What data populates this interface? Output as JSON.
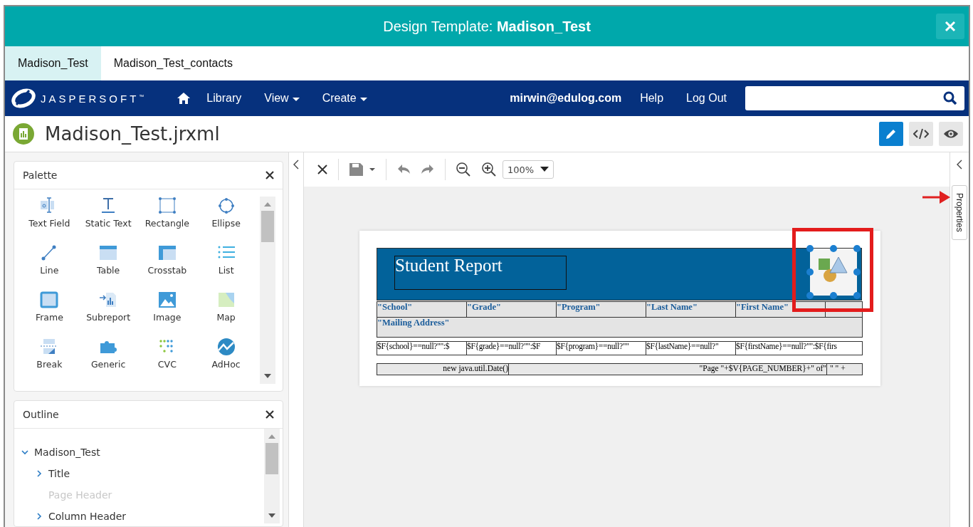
{
  "window": {
    "title_prefix": "Design Template: ",
    "title_name": "Madison_Test"
  },
  "tabs": [
    {
      "label": "Madison_Test",
      "selected": true
    },
    {
      "label": "Madison_Test_contacts",
      "selected": false
    }
  ],
  "nav": {
    "brand": "JASPERSOFT",
    "tm": "™",
    "items": [
      {
        "label": "Library",
        "dropdown": false
      },
      {
        "label": "View",
        "dropdown": true
      },
      {
        "label": "Create",
        "dropdown": true
      }
    ],
    "user": "mirwin@edulog.com",
    "links": [
      "Help",
      "Log Out"
    ]
  },
  "file": {
    "name": "Madison_Test.jrxml",
    "modes": [
      {
        "kind": "edit",
        "selected": true
      },
      {
        "kind": "code",
        "selected": false
      },
      {
        "kind": "preview",
        "selected": false
      }
    ]
  },
  "palette": {
    "title": "Palette",
    "items": [
      {
        "kind": "textfield",
        "label": "Text Field"
      },
      {
        "kind": "statictext",
        "label": "Static Text"
      },
      {
        "kind": "rectangle",
        "label": "Rectangle"
      },
      {
        "kind": "ellipse",
        "label": "Ellipse"
      },
      {
        "kind": "line",
        "label": "Line"
      },
      {
        "kind": "table",
        "label": "Table"
      },
      {
        "kind": "crosstab",
        "label": "Crosstab"
      },
      {
        "kind": "list",
        "label": "List"
      },
      {
        "kind": "frame",
        "label": "Frame"
      },
      {
        "kind": "subreport",
        "label": "Subreport"
      },
      {
        "kind": "image",
        "label": "Image"
      },
      {
        "kind": "map",
        "label": "Map"
      },
      {
        "kind": "break",
        "label": "Break"
      },
      {
        "kind": "generic",
        "label": "Generic"
      },
      {
        "kind": "cvc",
        "label": "CVC"
      },
      {
        "kind": "adhoc",
        "label": "AdHoc"
      }
    ]
  },
  "outline": {
    "title": "Outline",
    "tree": [
      {
        "label": "Madison_Test",
        "expanded": true,
        "disabled": false,
        "children": [
          {
            "label": "Title",
            "expanded": false,
            "disabled": false
          },
          {
            "label": "Page Header",
            "disabled": true
          },
          {
            "label": "Column Header",
            "expanded": false,
            "disabled": false
          }
        ]
      }
    ]
  },
  "toolbar": {
    "zoom": "100%"
  },
  "report": {
    "title": "Student Report",
    "headers": [
      "\"School\"",
      "\"Grade\"",
      "\"Program\"",
      "\"Last Name\"",
      "\"First Name\""
    ],
    "subheader": "\"Mailing Address\"",
    "fields": [
      "$F{school}==null?\"\":$",
      "$F{grade}==null?\"\":$F",
      "$F{program}==null?\"\"",
      "$F{lastName}==null?\"",
      "$F{firstName}==null?\"\":$F{firs"
    ],
    "footer": [
      "new java.util.Date()",
      "\"Page \"+$V{PAGE_NUMBER}+\" of\"",
      "\" \" +"
    ]
  },
  "properties_tab": "Properties"
}
